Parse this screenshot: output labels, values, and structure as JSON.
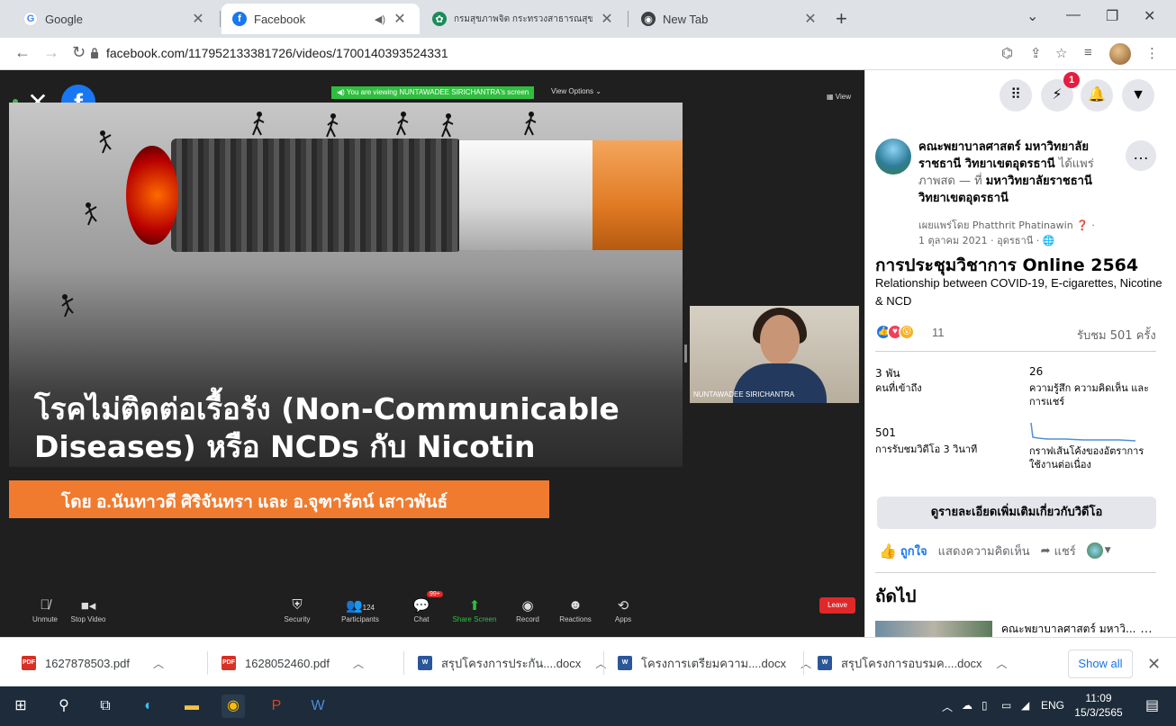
{
  "browser": {
    "tabs": [
      {
        "title": "Google",
        "favicon": "google-icon"
      },
      {
        "title": "Facebook",
        "favicon": "facebook-icon",
        "active": true
      },
      {
        "title": "กรมสุขภาพจิต กระทรวงสาธารณสุข",
        "favicon": "dmh-icon"
      },
      {
        "title": "New Tab",
        "favicon": "chrome-icon"
      }
    ],
    "url": "facebook.com/117952133381726/videos/1700140393524331"
  },
  "video": {
    "viewing_banner": "You are viewing NUNTAWADEE SIRICHANTRA's screen",
    "view_options": "View Options ⌄",
    "view_label": "View",
    "slide": {
      "title_line1": "โรคไม่ติดต่อเรื้อรัง (Non-Communicable",
      "title_line2": "Diseases) หรือ NCDs กับ Nicotin",
      "presenters": "โดย อ.นันทาวดี ศิริจันทรา และ อ.จุฑารัตน์ เสาวพันธ์"
    },
    "speaker_name": "NUNTAWADEE SIRICHANTRA",
    "zoom_bar": {
      "unmute": "Unmute",
      "stop_video": "Stop Video",
      "security": "Security",
      "participants": "Participants",
      "participants_count": "124",
      "chat": "Chat",
      "chat_badge": "99+",
      "share_screen": "Share Screen",
      "record": "Record",
      "reactions": "Reactions",
      "apps": "Apps",
      "leave": "Leave"
    }
  },
  "facebook": {
    "notifications_count": "1",
    "post": {
      "page_name_line1": "คณะพยาบาลศาสตร์ มหาวิทยาลัย",
      "page_name_line2": "ราชธานี วิทยาเขตอุดรธานี",
      "shared_text": "ได้แพร่",
      "shared_text2": "ภาพสด — ที่",
      "location_line1": "มหาวิทยาลัยราชธานี",
      "location_line2": "วิทยาเขตอุดรธานี",
      "published_by": "เผยแพร่โดย Phatthrit Phatinawin",
      "date": "1 ตุลาคม 2021 · อุดรธานี ·"
    },
    "video_title": "การประชุมวิชาการ Online 2564",
    "video_description": "Relationship between COVID-19, E-cigarettes, Nicotine & NCD",
    "reactions_count": "11",
    "views": "รับชม 501 ครั้ง",
    "stats": {
      "reach_value": "3 พัน",
      "reach_label": "คนที่เข้าถึง",
      "engagement_value": "26",
      "engagement_label_line1": "ความรู้สึก ความคิดเห็น และ",
      "engagement_label_line2": "การแชร์",
      "views3s_value": "501",
      "views3s_label": "การรับชมวิดีโอ 3 วินาที",
      "retention_label_line1": "กราฟเส้นโค้งของอัตราการ",
      "retention_label_line2": "ใช้งานต่อเนื่อง"
    },
    "details_button": "ดูรายละเอียดเพิ่มเติมเกี่ยวกับวิดีโอ",
    "actions": {
      "like": "ถูกใจ",
      "comment": "แสดงความคิดเห็น",
      "share": "แชร์"
    },
    "next_heading": "ถัดไป",
    "next_item": "คณะพยาบาลศาสตร์ มหาวิ..."
  },
  "downloads": {
    "items": [
      {
        "name": "1627878503.pdf",
        "type": "PDF"
      },
      {
        "name": "1628052460.pdf",
        "type": "PDF"
      },
      {
        "name": "สรุปโครงการประกัน....docx",
        "type": "W"
      },
      {
        "name": "โครงการเตรียมความ....docx",
        "type": "W"
      },
      {
        "name": "สรุปโครงการอบรมค....docx",
        "type": "W"
      }
    ],
    "show_all": "Show all"
  },
  "taskbar": {
    "language": "ENG",
    "time": "11:09",
    "date": "15/3/2565"
  },
  "colors": {
    "facebook_blue": "#1877f2",
    "zoom_green": "#2fbf3e",
    "slide_orange": "#f07b2f",
    "leave_red": "#e02828"
  }
}
